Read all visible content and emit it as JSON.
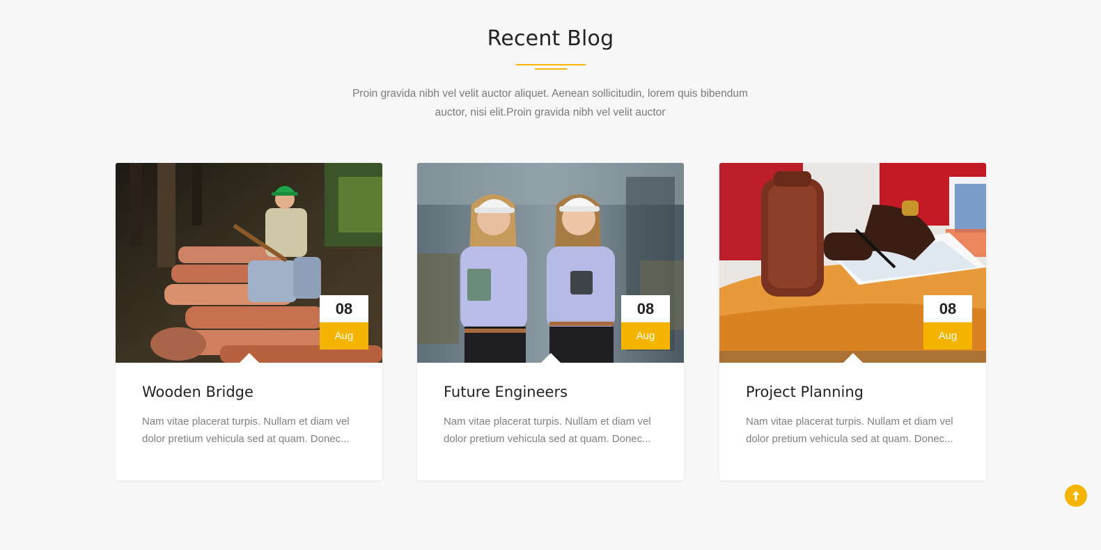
{
  "section": {
    "title": "Recent Blog",
    "intro": "Proin gravida nibh vel velit auctor aliquet. Aenean sollicitudin, lorem quis bibendum auctor, nisi elit.Proin gravida nibh vel velit auctor"
  },
  "posts": [
    {
      "title": "Wooden Bridge",
      "excerpt": "Nam vitae placerat turpis. Nullam et diam vel dolor pretium vehicula sed at quam. Donec...",
      "day": "08",
      "month": "Aug",
      "image": "worker-with-logs-photo"
    },
    {
      "title": "Future Engineers",
      "excerpt": "Nam vitae placerat turpis. Nullam et diam vel dolor pretium vehicula sed at quam. Donec...",
      "day": "08",
      "month": "Aug",
      "image": "two-engineers-photo"
    },
    {
      "title": "Project Planning",
      "excerpt": "Nam vitae placerat turpis. Nullam et diam vel dolor pretium vehicula sed at quam. Donec...",
      "day": "08",
      "month": "Aug",
      "image": "project-planning-photo"
    }
  ],
  "scroll_top": {
    "icon": "arrow-up-icon"
  },
  "colors": {
    "accent": "#f5b400",
    "background": "#f7f7f7",
    "heading": "#222222",
    "body_text": "#808080"
  }
}
